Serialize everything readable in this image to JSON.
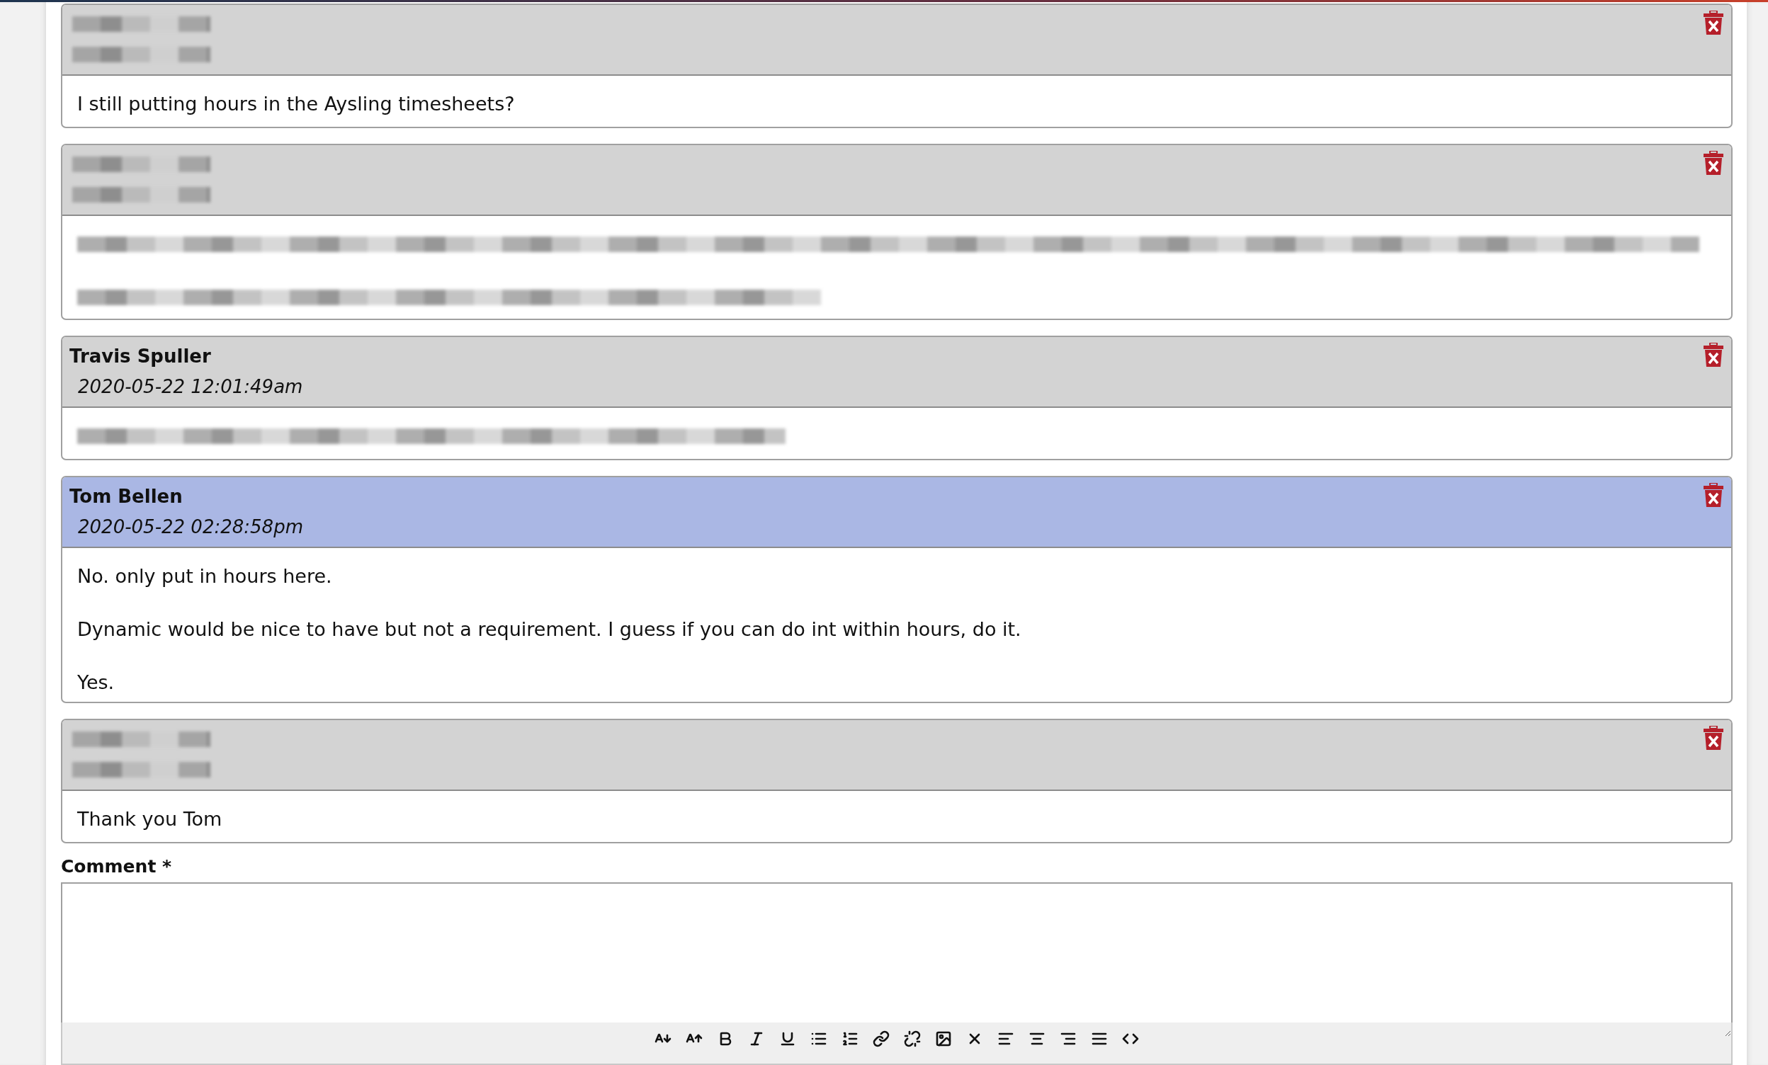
{
  "comments": [
    {
      "highlighted": false,
      "header": [
        {
          "kind": "redacted"
        },
        {
          "kind": "redacted"
        }
      ],
      "body": [
        {
          "kind": "text",
          "text": "I still putting hours in the Aysling timesheets?"
        }
      ]
    },
    {
      "highlighted": false,
      "header": [
        {
          "kind": "redacted"
        },
        {
          "kind": "redacted"
        }
      ],
      "body": [
        {
          "kind": "redacted"
        },
        {
          "kind": "redacted"
        }
      ]
    },
    {
      "highlighted": false,
      "header": [
        {
          "kind": "author",
          "text": "Travis Spuller"
        },
        {
          "kind": "timestamp",
          "text": "2020-05-22 12:01:49am"
        }
      ],
      "body": [
        {
          "kind": "redacted"
        }
      ]
    },
    {
      "highlighted": true,
      "header": [
        {
          "kind": "author",
          "text": "Tom Bellen"
        },
        {
          "kind": "timestamp",
          "text": "2020-05-22 02:28:58pm"
        }
      ],
      "body": [
        {
          "kind": "text",
          "text": "No. only put in hours here."
        },
        {
          "kind": "text",
          "text": "Dynamic would be nice to have but not a requirement. I guess if you can do int within hours, do it."
        },
        {
          "kind": "text",
          "text": "Yes."
        }
      ]
    },
    {
      "highlighted": false,
      "header": [
        {
          "kind": "redacted"
        },
        {
          "kind": "redacted"
        }
      ],
      "body": [
        {
          "kind": "text",
          "text": "Thank you Tom"
        }
      ]
    }
  ],
  "comment_field": {
    "label": "Comment *"
  }
}
